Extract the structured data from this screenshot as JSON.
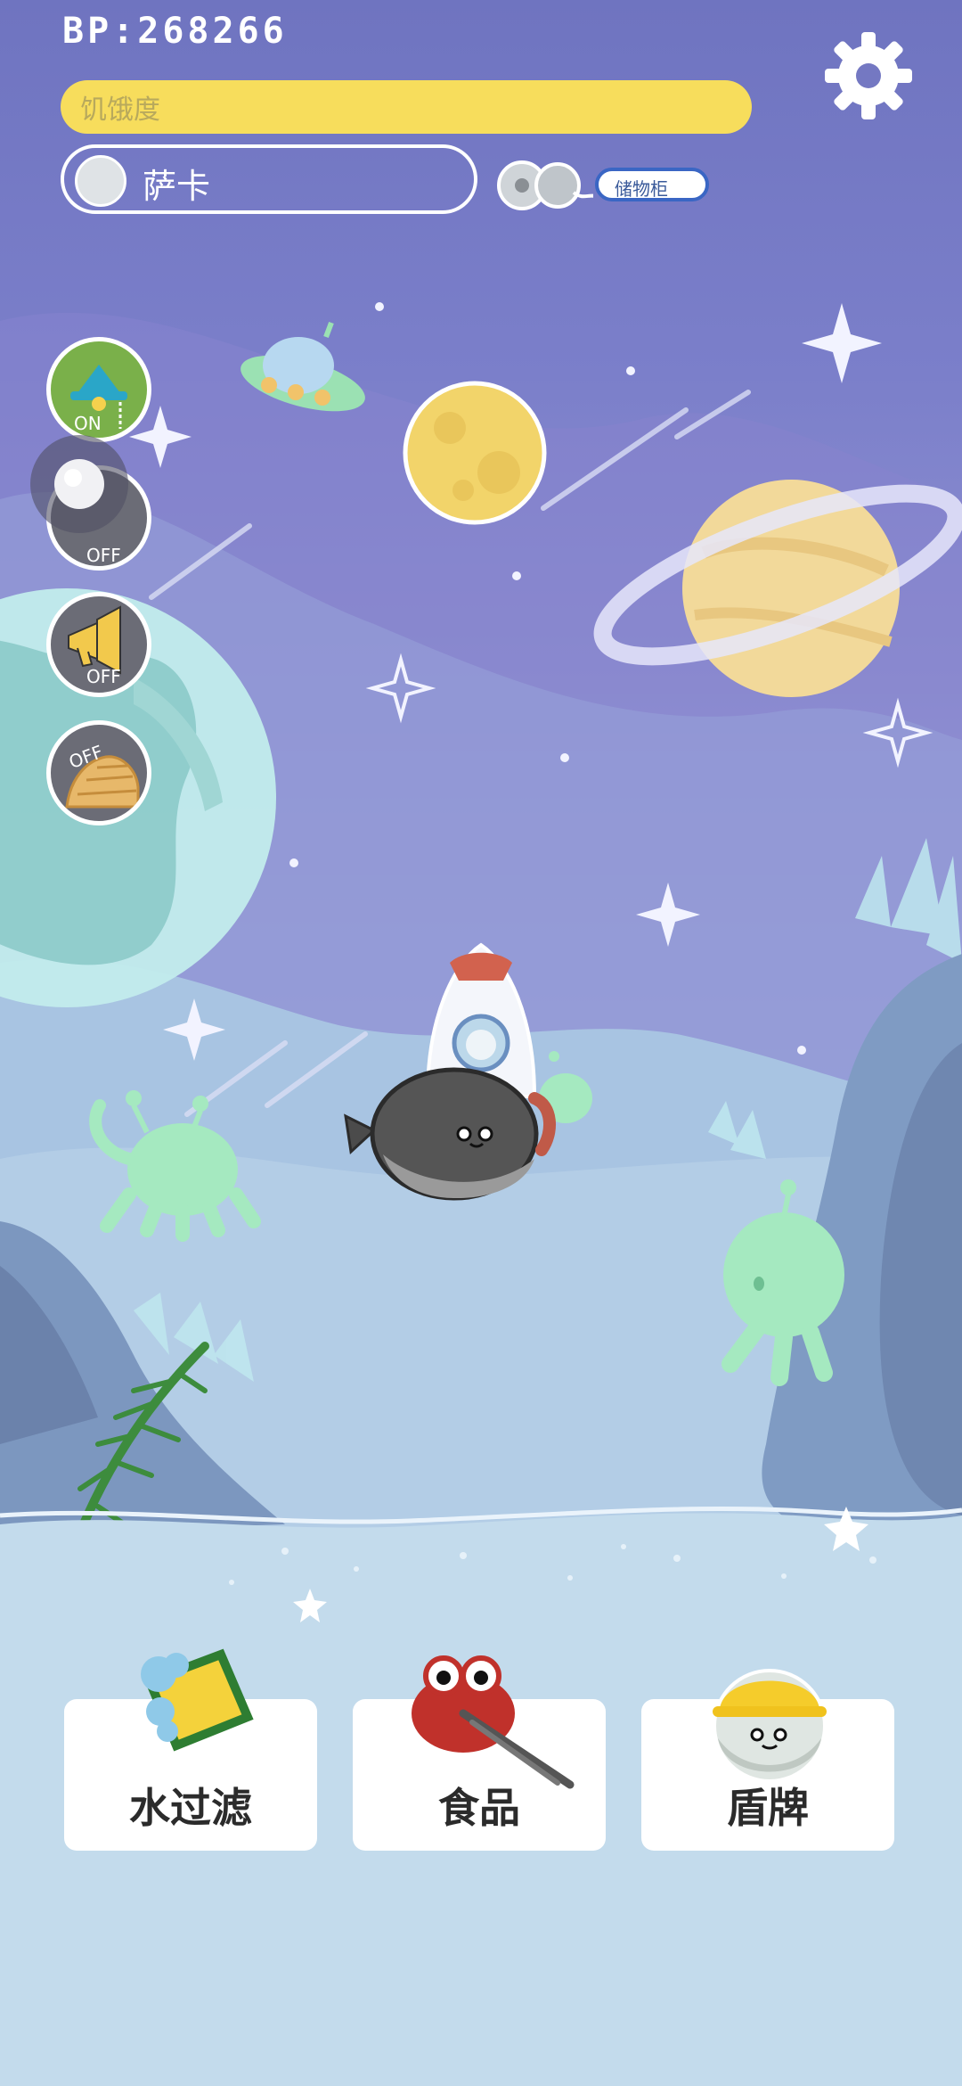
{
  "hud": {
    "bp_text": "BP:268266",
    "hunger_label": "饥饿度",
    "pet_name": "萨卡",
    "locker_label": "储物柜"
  },
  "toggles": [
    {
      "name": "lamp",
      "state": "ON"
    },
    {
      "name": "light-orb",
      "state": "OFF"
    },
    {
      "name": "speaker",
      "state": "OFF"
    },
    {
      "name": "shell",
      "state": "OFF"
    }
  ],
  "actions": [
    {
      "label": "水过滤"
    },
    {
      "label": "食品"
    },
    {
      "label": "盾牌"
    }
  ],
  "colors": {
    "sky_top": "#6f74c0",
    "hunger_bar": "#f7dd5c",
    "locker_border": "#3a66c4"
  }
}
